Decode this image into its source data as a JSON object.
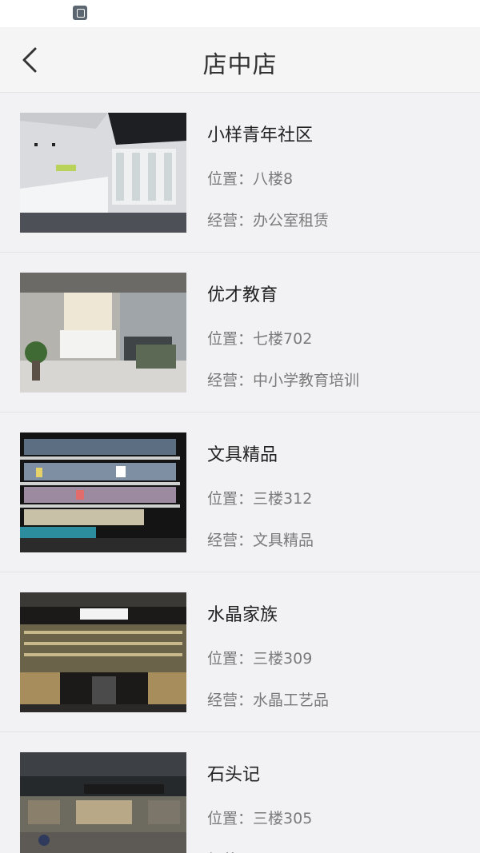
{
  "header": {
    "title": "店中店"
  },
  "labels": {
    "location_prefix": "位置：",
    "business_prefix": "经营："
  },
  "stores": [
    {
      "name": "小样青年社区",
      "location": "八楼8",
      "business": "办公室租赁",
      "image": "office-lobby"
    },
    {
      "name": "优才教育",
      "location": "七楼702",
      "business": "中小学教育培训",
      "image": "education-reception"
    },
    {
      "name": "文具精品",
      "location": "三楼312",
      "business": "文具精品",
      "image": "stationery-shelves"
    },
    {
      "name": "水晶家族",
      "location": "三楼309",
      "business": "水晶工艺品",
      "image": "crystal-shop"
    },
    {
      "name": "石头记",
      "location": "三楼305",
      "business": "",
      "image": "stone-shop"
    }
  ]
}
